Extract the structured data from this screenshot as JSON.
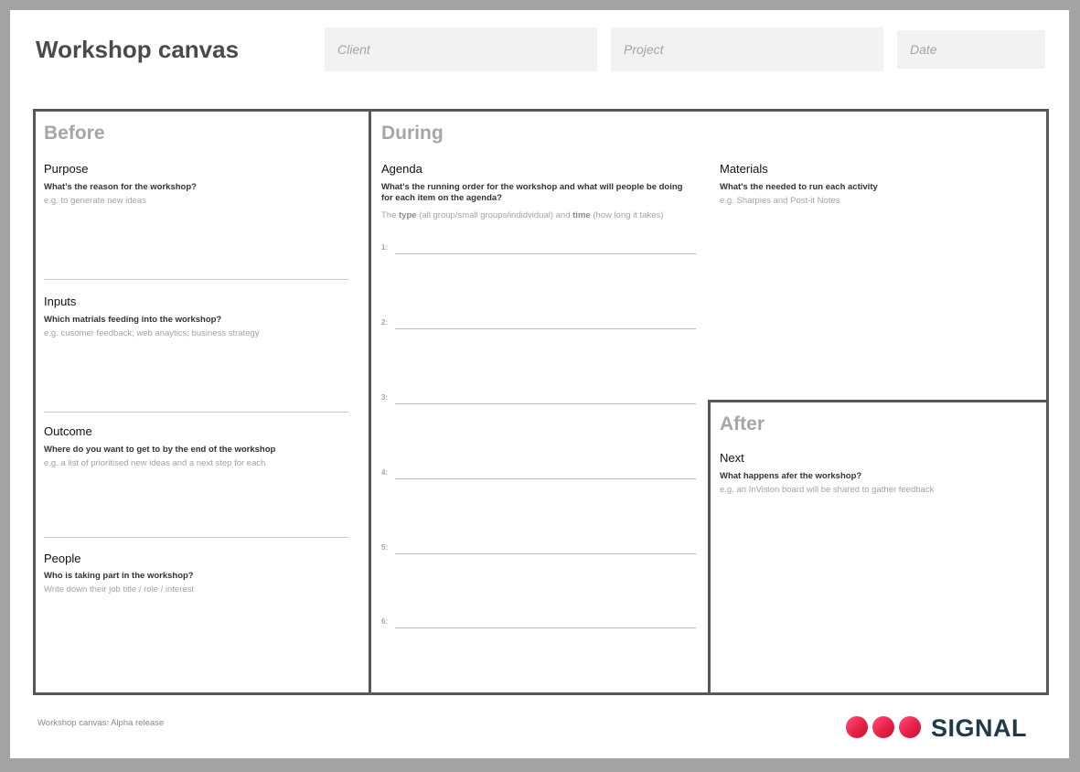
{
  "header": {
    "title": "Workshop canvas",
    "client_placeholder": "Client",
    "project_placeholder": "Project",
    "date_placeholder": "Date"
  },
  "before": {
    "title": "Before",
    "purpose": {
      "label": "Purpose",
      "prompt": "What's the reason for the workshop?",
      "example": "e.g. to generate new ideas"
    },
    "inputs": {
      "label": "Inputs",
      "prompt": "Which matrials feeding into the workshop?",
      "example": "e.g. cusomer feedback; web anaytics; business strategy"
    },
    "outcome": {
      "label": "Outcome",
      "prompt": "Where do you want to get to by the end of the workshop",
      "example": "e.g. a list of prioritised new ideas and a next step for each"
    },
    "people": {
      "label": "People",
      "prompt": "Who is taking part in the workshop?",
      "example": "Write down their job title / role / interest"
    }
  },
  "during": {
    "title": "During",
    "agenda": {
      "label": "Agenda",
      "prompt_line1": "What's the running order for the workshop and what will people be doing",
      "prompt_line2": "for each item on the agenda?",
      "hint_pre": "The ",
      "hint_type": "type",
      "hint_mid": " (all group/small groups/indidvidual) and ",
      "hint_time": "time",
      "hint_post": " (how long it takes)",
      "items": [
        "1:",
        "2:",
        "3:",
        "4:",
        "5:",
        "6:"
      ]
    },
    "materials": {
      "label": "Materials",
      "prompt": "What's the needed to run each activity",
      "example": "e.g. Sharpies and Post-it Notes"
    }
  },
  "after": {
    "title": "After",
    "next": {
      "label": "Next",
      "prompt": "What happens afer the workshop?",
      "example": "e.g. an InVision board will be shared to gather feedback"
    }
  },
  "footer": {
    "note": "Workshop canvas: Alpha release",
    "logo_text": "SIGNAL"
  },
  "colors": {
    "frame": "#58585a",
    "section_title": "#a6a6a6",
    "logo_dots": "#e8214a",
    "logo_text": "#1f3a48"
  }
}
